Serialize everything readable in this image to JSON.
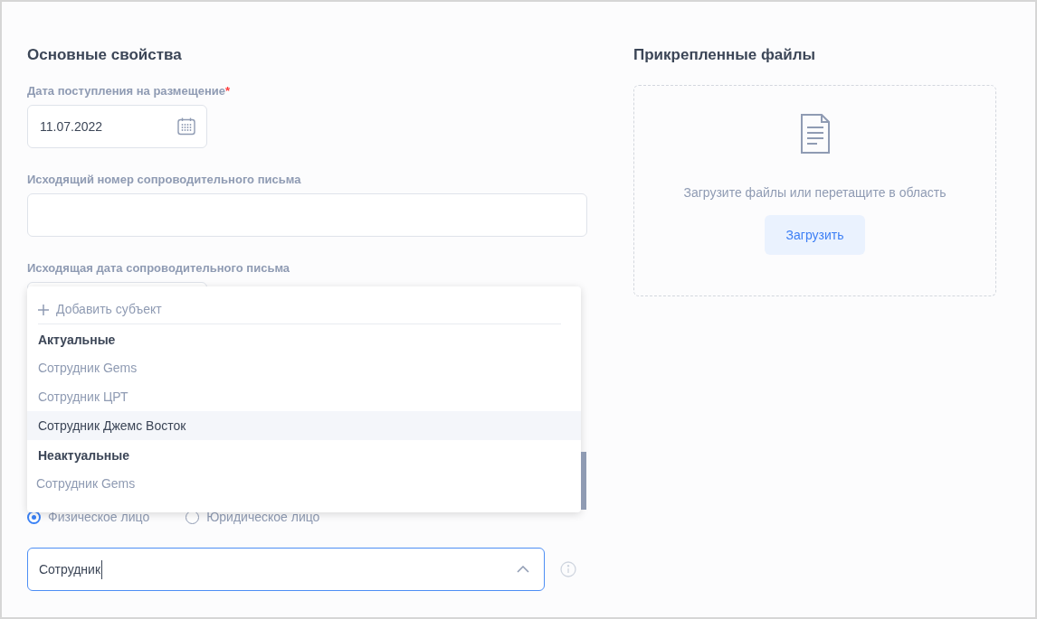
{
  "main_section": {
    "title": "Основные свойства",
    "fields": [
      {
        "kind": "date",
        "label": "Дата поступления на размещение",
        "required_mark": "*",
        "value": "11.07.2022",
        "calendar_button": true
      },
      {
        "kind": "text",
        "label": "Исходящий номер сопроводительного письма"
      },
      {
        "kind": "date",
        "label": "Исходящая дата сопроводительного письма"
      }
    ],
    "subject_type": [
      {
        "label": "Физическое лицо",
        "selected": true
      },
      {
        "label": "Юридическое лицо",
        "selected": false
      }
    ],
    "subject_select": {
      "value": "Сотрудник",
      "expanded": true
    }
  },
  "dropdown": {
    "add_action": "Добавить субъект",
    "groups": [
      {
        "title": "Актуальные",
        "items": [
          {
            "label": "Сотрудник Gems",
            "highlighted": false
          },
          {
            "label": "Сотрудник ЦРТ",
            "highlighted": false
          },
          {
            "label": "Сотрудник Джемс Восток",
            "highlighted": true
          }
        ]
      },
      {
        "title": "Неактуальные",
        "items": [
          {
            "label": "Сотрудник Gems",
            "highlighted": false
          }
        ]
      }
    ]
  },
  "attachments": {
    "title": "Прикрепленные файлы",
    "hint": "Загрузите файлы или перетащите в область",
    "button": "Загрузить"
  }
}
